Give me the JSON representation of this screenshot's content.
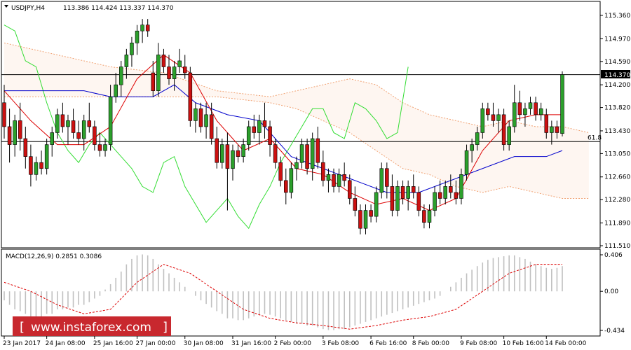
{
  "header": {
    "symbol": "USDJPY,H4",
    "ohlc": "113.386 114.424 113.337 114.370"
  },
  "price_badge": "114.370",
  "fib_label": "61.8",
  "macd": {
    "title": "MACD(12,26,9) 0.2851 0.3086",
    "ticks": [
      "0.406",
      "0.00",
      "-0.434"
    ],
    "range": [
      -0.434,
      0.406
    ]
  },
  "watermark": "www.instaforex.com",
  "colors": {
    "bull": "#2ca02c",
    "bear": "#cc1111",
    "tenkan": "#dd0000",
    "kijun": "#0000cc",
    "chikou": "#33dd33",
    "cloud": "#f0a070",
    "macd_hist": "#c0c0c0",
    "macd_signal": "#dd0000"
  },
  "chart_data": {
    "type": "candlestick",
    "price_ticks": [
      "115.360",
      "114.970",
      "114.590",
      "114.200",
      "113.820",
      "113.430",
      "113.050",
      "112.660",
      "112.280",
      "111.890",
      "111.510"
    ],
    "ylim": [
      111.51,
      115.36
    ],
    "time_ticks": [
      "23 Jan 2017",
      "24 Jan 08:00",
      "25 Jan 16:00",
      "27 Jan 00:00",
      "30 Jan 08:00",
      "31 Jan 16:00",
      "2 Feb 00:00",
      "3 Feb 08:00",
      "6 Feb 16:00",
      "8 Feb 00:00",
      "9 Feb 08:00",
      "10 Feb 16:00",
      "14 Feb 00:00"
    ],
    "hline_current": 114.37,
    "hline_fib": 113.25,
    "candles": [
      [
        113.9,
        114.2,
        113.3,
        113.5
      ],
      [
        113.5,
        113.8,
        112.9,
        113.2
      ],
      [
        113.2,
        113.7,
        113.0,
        113.6
      ],
      [
        113.6,
        113.9,
        113.1,
        113.3
      ],
      [
        113.3,
        113.5,
        112.8,
        113.0
      ],
      [
        113.0,
        113.2,
        112.5,
        112.7
      ],
      [
        112.7,
        113.0,
        112.6,
        112.9
      ],
      [
        112.9,
        113.1,
        112.7,
        112.8
      ],
      [
        112.8,
        113.3,
        112.7,
        113.2
      ],
      [
        113.2,
        113.5,
        113.0,
        113.4
      ],
      [
        113.4,
        113.8,
        113.3,
        113.7
      ],
      [
        113.7,
        113.9,
        113.4,
        113.5
      ],
      [
        113.5,
        113.7,
        113.2,
        113.6
      ],
      [
        113.6,
        113.8,
        113.3,
        113.4
      ],
      [
        113.4,
        113.6,
        113.2,
        113.3
      ],
      [
        113.3,
        113.7,
        113.1,
        113.6
      ],
      [
        113.6,
        113.9,
        113.4,
        113.5
      ],
      [
        113.5,
        113.6,
        113.1,
        113.2
      ],
      [
        113.2,
        113.4,
        113.0,
        113.1
      ],
      [
        113.1,
        113.3,
        113.0,
        113.2
      ],
      [
        113.2,
        114.2,
        113.1,
        114.0
      ],
      [
        114.0,
        114.4,
        113.9,
        114.2
      ],
      [
        114.2,
        114.6,
        114.0,
        114.5
      ],
      [
        114.5,
        114.8,
        114.3,
        114.7
      ],
      [
        114.7,
        115.0,
        114.5,
        114.9
      ],
      [
        114.9,
        115.2,
        114.7,
        115.1
      ],
      [
        115.1,
        115.3,
        114.9,
        115.2
      ],
      [
        115.2,
        115.3,
        115.0,
        115.1
      ],
      [
        114.4,
        114.6,
        114.0,
        114.1
      ],
      [
        114.1,
        114.9,
        114.0,
        114.7
      ],
      [
        114.7,
        114.8,
        114.4,
        114.5
      ],
      [
        114.5,
        114.7,
        114.2,
        114.3
      ],
      [
        114.3,
        114.6,
        114.1,
        114.5
      ],
      [
        114.5,
        114.8,
        114.4,
        114.6
      ],
      [
        114.5,
        114.7,
        114.3,
        114.4
      ],
      [
        114.4,
        114.5,
        113.5,
        113.6
      ],
      [
        113.6,
        113.9,
        113.4,
        113.8
      ],
      [
        113.8,
        113.9,
        113.4,
        113.5
      ],
      [
        113.5,
        113.9,
        113.3,
        113.7
      ],
      [
        113.7,
        113.9,
        113.2,
        113.3
      ],
      [
        113.3,
        113.5,
        112.8,
        112.9
      ],
      [
        112.9,
        113.3,
        112.8,
        113.2
      ],
      [
        113.2,
        113.4,
        112.1,
        112.8
      ],
      [
        112.8,
        113.2,
        112.6,
        113.1
      ],
      [
        113.1,
        113.2,
        112.9,
        113.0
      ],
      [
        113.0,
        113.3,
        112.9,
        113.2
      ],
      [
        113.2,
        113.6,
        113.1,
        113.5
      ],
      [
        113.5,
        113.7,
        113.3,
        113.4
      ],
      [
        113.4,
        113.7,
        113.2,
        113.6
      ],
      [
        113.6,
        113.9,
        113.3,
        113.5
      ],
      [
        113.5,
        113.6,
        113.0,
        113.2
      ],
      [
        113.2,
        113.3,
        112.8,
        112.9
      ],
      [
        112.9,
        113.0,
        112.5,
        112.6
      ],
      [
        112.6,
        112.8,
        112.2,
        112.4
      ],
      [
        112.4,
        112.9,
        112.3,
        112.8
      ],
      [
        112.8,
        113.0,
        112.6,
        112.9
      ],
      [
        112.9,
        113.3,
        112.8,
        113.2
      ],
      [
        113.2,
        113.3,
        112.7,
        112.8
      ],
      [
        112.8,
        113.4,
        112.6,
        113.3
      ],
      [
        113.3,
        113.5,
        112.8,
        112.9
      ],
      [
        112.9,
        113.1,
        112.5,
        112.6
      ],
      [
        112.6,
        112.8,
        112.4,
        112.7
      ],
      [
        112.7,
        112.8,
        112.4,
        112.5
      ],
      [
        112.5,
        112.8,
        112.4,
        112.7
      ],
      [
        112.7,
        112.9,
        112.5,
        112.6
      ],
      [
        112.6,
        112.7,
        112.2,
        112.3
      ],
      [
        112.3,
        112.5,
        112.0,
        112.1
      ],
      [
        112.1,
        112.2,
        111.7,
        111.8
      ],
      [
        111.8,
        112.2,
        111.7,
        112.1
      ],
      [
        112.1,
        112.2,
        111.9,
        112.0
      ],
      [
        112.0,
        112.5,
        111.9,
        112.4
      ],
      [
        112.4,
        112.9,
        112.3,
        112.8
      ],
      [
        112.8,
        112.9,
        112.3,
        112.5
      ],
      [
        112.5,
        112.7,
        112.0,
        112.1
      ],
      [
        112.1,
        112.6,
        112.0,
        112.5
      ],
      [
        112.5,
        112.6,
        112.2,
        112.3
      ],
      [
        112.3,
        112.6,
        112.1,
        112.5
      ],
      [
        112.5,
        112.7,
        112.3,
        112.4
      ],
      [
        112.4,
        112.5,
        112.0,
        112.1
      ],
      [
        112.1,
        112.2,
        111.8,
        111.9
      ],
      [
        111.9,
        112.2,
        111.8,
        112.1
      ],
      [
        112.1,
        112.5,
        112.0,
        112.4
      ],
      [
        112.4,
        112.6,
        112.2,
        112.3
      ],
      [
        112.3,
        112.6,
        112.2,
        112.5
      ],
      [
        112.5,
        112.7,
        112.3,
        112.4
      ],
      [
        112.4,
        112.6,
        112.2,
        112.3
      ],
      [
        112.3,
        112.8,
        112.2,
        112.7
      ],
      [
        112.7,
        113.2,
        112.6,
        113.1
      ],
      [
        113.1,
        113.3,
        112.9,
        113.2
      ],
      [
        113.2,
        113.5,
        113.1,
        113.4
      ],
      [
        113.4,
        113.9,
        113.3,
        113.8
      ],
      [
        113.8,
        113.9,
        113.6,
        113.7
      ],
      [
        113.7,
        113.9,
        113.5,
        113.6
      ],
      [
        113.6,
        113.8,
        113.4,
        113.7
      ],
      [
        113.7,
        113.8,
        113.1,
        113.2
      ],
      [
        113.2,
        113.6,
        113.1,
        113.5
      ],
      [
        113.5,
        114.2,
        113.4,
        113.9
      ],
      [
        113.9,
        114.1,
        113.6,
        113.7
      ],
      [
        113.7,
        113.9,
        113.5,
        113.8
      ],
      [
        113.8,
        114.0,
        113.7,
        113.9
      ],
      [
        113.9,
        114.0,
        113.6,
        113.7
      ],
      [
        113.7,
        113.9,
        113.6,
        113.8
      ],
      [
        113.7,
        113.8,
        113.3,
        113.4
      ],
      [
        113.4,
        113.6,
        113.2,
        113.5
      ],
      [
        113.5,
        113.6,
        113.3,
        113.4
      ],
      [
        113.386,
        114.424,
        113.337,
        114.37
      ]
    ],
    "tenkan": [
      [
        0,
        114.1
      ],
      [
        5,
        113.6
      ],
      [
        10,
        113.2
      ],
      [
        15,
        113.2
      ],
      [
        20,
        113.5
      ],
      [
        25,
        114.3
      ],
      [
        30,
        114.7
      ],
      [
        35,
        114.4
      ],
      [
        40,
        113.6
      ],
      [
        45,
        113.1
      ],
      [
        50,
        113.3
      ],
      [
        55,
        112.8
      ],
      [
        60,
        112.7
      ],
      [
        65,
        112.4
      ],
      [
        70,
        112.2
      ],
      [
        75,
        112.3
      ],
      [
        80,
        112.1
      ],
      [
        85,
        112.3
      ],
      [
        90,
        113.1
      ],
      [
        95,
        113.6
      ],
      [
        100,
        113.7
      ],
      [
        105,
        113.7
      ]
    ],
    "kijun": [
      [
        0,
        114.1
      ],
      [
        15,
        114.1
      ],
      [
        20,
        114.0
      ],
      [
        24,
        114.0
      ],
      [
        28,
        114.0
      ],
      [
        32,
        114.2
      ],
      [
        36,
        113.9
      ],
      [
        42,
        113.7
      ],
      [
        48,
        113.6
      ],
      [
        54,
        113.0
      ],
      [
        60,
        112.8
      ],
      [
        66,
        112.6
      ],
      [
        72,
        112.4
      ],
      [
        78,
        112.4
      ],
      [
        84,
        112.6
      ],
      [
        90,
        112.8
      ],
      [
        96,
        113.0
      ],
      [
        102,
        113.0
      ],
      [
        105,
        113.1
      ]
    ],
    "chikou": [
      [
        0,
        115.2
      ],
      [
        2,
        115.1
      ],
      [
        4,
        114.6
      ],
      [
        6,
        114.5
      ],
      [
        8,
        113.9
      ],
      [
        10,
        113.4
      ],
      [
        12,
        113.1
      ],
      [
        14,
        112.9
      ],
      [
        16,
        113.2
      ],
      [
        18,
        113.4
      ],
      [
        20,
        113.2
      ],
      [
        22,
        113.0
      ],
      [
        24,
        112.8
      ],
      [
        26,
        112.5
      ],
      [
        28,
        112.4
      ],
      [
        30,
        112.9
      ],
      [
        32,
        113.0
      ],
      [
        34,
        112.5
      ],
      [
        36,
        112.2
      ],
      [
        38,
        111.9
      ],
      [
        40,
        112.1
      ],
      [
        42,
        112.3
      ],
      [
        44,
        112.0
      ],
      [
        46,
        111.8
      ],
      [
        48,
        112.2
      ],
      [
        50,
        112.5
      ],
      [
        52,
        112.9
      ],
      [
        54,
        113.2
      ],
      [
        56,
        113.5
      ],
      [
        58,
        113.8
      ],
      [
        60,
        113.8
      ],
      [
        62,
        113.4
      ],
      [
        64,
        113.3
      ],
      [
        66,
        113.9
      ],
      [
        68,
        113.8
      ],
      [
        70,
        113.6
      ],
      [
        72,
        113.3
      ],
      [
        74,
        113.4
      ],
      [
        76,
        114.5
      ]
    ],
    "cloud_upper": [
      [
        0,
        114.9
      ],
      [
        10,
        114.7
      ],
      [
        20,
        114.5
      ],
      [
        30,
        114.4
      ],
      [
        40,
        114.1
      ],
      [
        50,
        114.0
      ],
      [
        55,
        114.1
      ],
      [
        60,
        114.2
      ],
      [
        65,
        114.3
      ],
      [
        70,
        114.2
      ],
      [
        75,
        113.9
      ],
      [
        80,
        113.7
      ],
      [
        85,
        113.6
      ],
      [
        90,
        113.5
      ],
      [
        95,
        113.6
      ],
      [
        100,
        113.5
      ],
      [
        105,
        113.5
      ],
      [
        110,
        113.4
      ]
    ],
    "cloud_lower": [
      [
        0,
        114.0
      ],
      [
        10,
        114.0
      ],
      [
        20,
        114.0
      ],
      [
        30,
        114.0
      ],
      [
        40,
        114.0
      ],
      [
        50,
        113.9
      ],
      [
        55,
        113.8
      ],
      [
        60,
        113.6
      ],
      [
        65,
        113.4
      ],
      [
        70,
        113.1
      ],
      [
        75,
        112.8
      ],
      [
        80,
        112.7
      ],
      [
        85,
        112.5
      ],
      [
        90,
        112.4
      ],
      [
        95,
        112.5
      ],
      [
        100,
        112.4
      ],
      [
        105,
        112.3
      ],
      [
        110,
        112.3
      ]
    ],
    "macd_hist": [
      -0.1,
      -0.15,
      -0.2,
      -0.22,
      -0.25,
      -0.3,
      -0.3,
      -0.28,
      -0.25,
      -0.25,
      -0.2,
      -0.2,
      -0.18,
      -0.18,
      -0.15,
      -0.15,
      -0.12,
      -0.08,
      -0.05,
      0.02,
      0.08,
      0.15,
      0.22,
      0.3,
      0.36,
      0.4,
      0.41,
      0.4,
      0.36,
      0.3,
      0.25,
      0.2,
      0.15,
      0.1,
      0.05,
      0.0,
      -0.05,
      -0.1,
      -0.14,
      -0.18,
      -0.22,
      -0.25,
      -0.3,
      -0.3,
      -0.32,
      -0.32,
      -0.3,
      -0.28,
      -0.26,
      -0.25,
      -0.26,
      -0.28,
      -0.3,
      -0.32,
      -0.34,
      -0.36,
      -0.36,
      -0.38,
      -0.38,
      -0.4,
      -0.42,
      -0.43,
      -0.43,
      -0.42,
      -0.42,
      -0.4,
      -0.38,
      -0.36,
      -0.34,
      -0.32,
      -0.3,
      -0.28,
      -0.26,
      -0.24,
      -0.22,
      -0.2,
      -0.18,
      -0.16,
      -0.14,
      -0.12,
      -0.1,
      -0.08,
      -0.05,
      0.0,
      0.05,
      0.1,
      0.15,
      0.2,
      0.24,
      0.28,
      0.32,
      0.35,
      0.37,
      0.38,
      0.39,
      0.4,
      0.4,
      0.38,
      0.36,
      0.33,
      0.3,
      0.28,
      0.26,
      0.25,
      0.26,
      0.28
    ],
    "macd_signal": [
      [
        0,
        0.1
      ],
      [
        5,
        0.0
      ],
      [
        10,
        -0.15
      ],
      [
        15,
        -0.25
      ],
      [
        20,
        -0.2
      ],
      [
        25,
        0.1
      ],
      [
        30,
        0.3
      ],
      [
        35,
        0.2
      ],
      [
        40,
        0.0
      ],
      [
        45,
        -0.2
      ],
      [
        50,
        -0.3
      ],
      [
        55,
        -0.35
      ],
      [
        60,
        -0.38
      ],
      [
        65,
        -0.42
      ],
      [
        70,
        -0.38
      ],
      [
        75,
        -0.32
      ],
      [
        80,
        -0.28
      ],
      [
        85,
        -0.2
      ],
      [
        90,
        0.0
      ],
      [
        95,
        0.2
      ],
      [
        100,
        0.3
      ],
      [
        105,
        0.3
      ]
    ]
  }
}
